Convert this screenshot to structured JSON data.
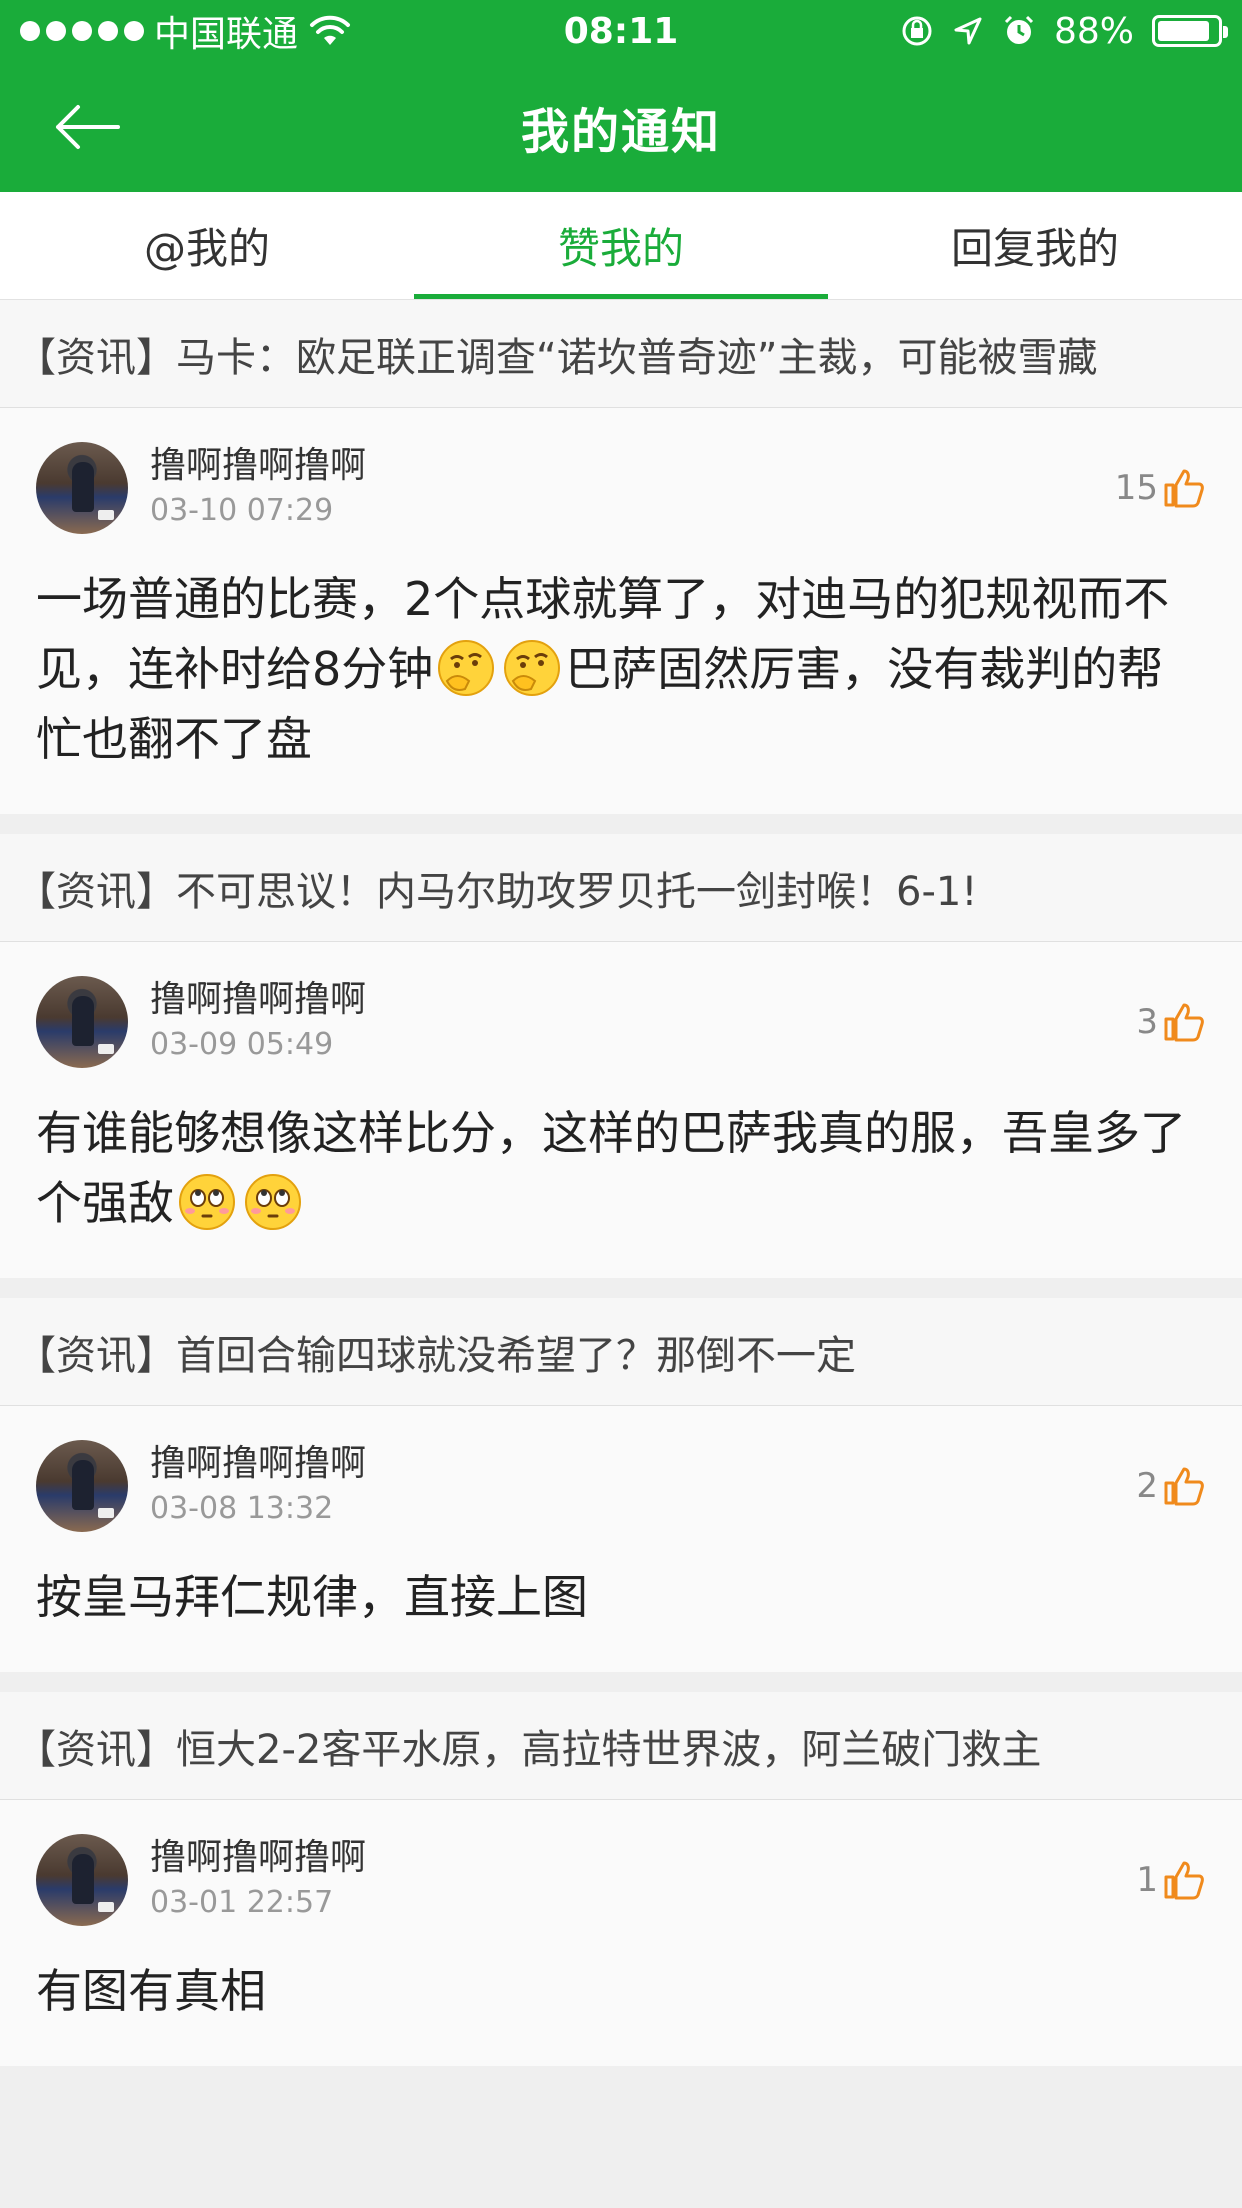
{
  "status_bar": {
    "carrier": "中国联通",
    "time": "08:11",
    "battery_pct": "88%",
    "battery_level": 0.88
  },
  "nav": {
    "title": "我的通知"
  },
  "tabs": [
    {
      "label": "@我的",
      "active": false
    },
    {
      "label": "赞我的",
      "active": true
    },
    {
      "label": "回复我的",
      "active": false
    }
  ],
  "notifications": [
    {
      "title": "【资讯】马卡：欧足联正调查“诺坎普奇迹”主裁，可能被雪藏",
      "username": "撸啊撸啊撸啊",
      "time": "03-10 07:29",
      "likes": "15",
      "content_a": "一场普通的比赛，2个点球就算了，对迪马的犯规视而不见，连补时给8分钟",
      "content_b": "巴萨固然厉害，没有裁判的帮忙也翻不了盘",
      "emoji": "thinking-emoji"
    },
    {
      "title": "【资讯】不可思议！内马尔助攻罗贝托一剑封喉！6-1!",
      "username": "撸啊撸啊撸啊",
      "time": "03-09 05:49",
      "likes": "3",
      "content_a": "有谁能够想像这样比分，这样的巴萨我真的服，吾皇多了个强敌",
      "content_b": "",
      "emoji": "eye-roll-emoji"
    },
    {
      "title": "【资讯】首回合输四球就没希望了？那倒不一定",
      "username": "撸啊撸啊撸啊",
      "time": "03-08 13:32",
      "likes": "2",
      "content_a": "按皇马拜仁规律，直接上图",
      "content_b": ""
    },
    {
      "title": "【资讯】恒大2-2客平水原，高拉特世界波，阿兰破门救主",
      "username": "撸啊撸啊撸啊",
      "time": "03-01 22:57",
      "likes": "1",
      "content_a": "有图有真相",
      "content_b": ""
    }
  ],
  "colors": {
    "brand_green": "#1aac3a",
    "like_orange": "#f08a1c"
  }
}
